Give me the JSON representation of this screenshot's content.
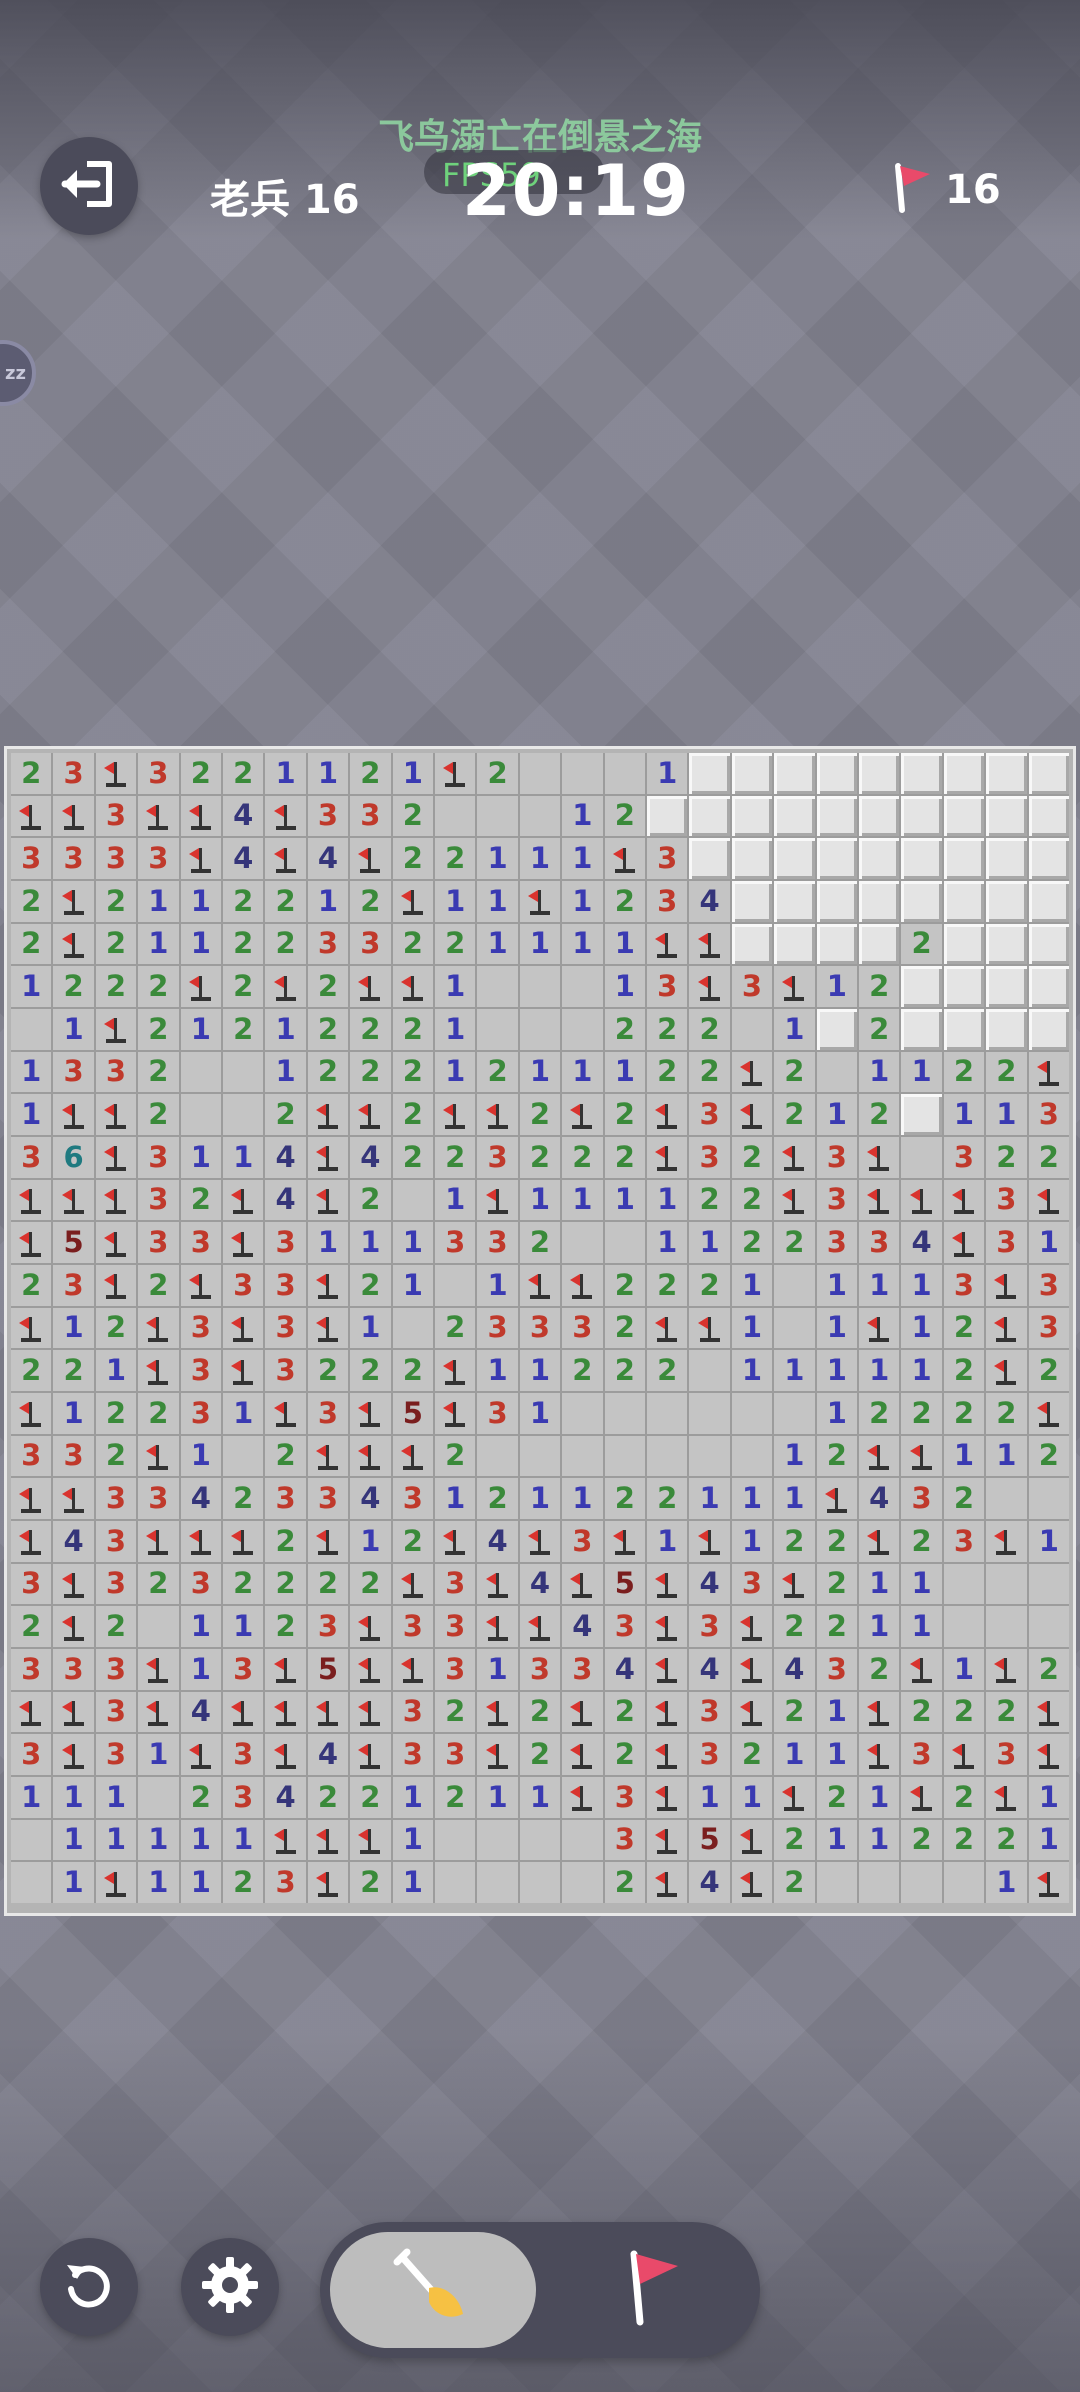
{
  "header": {
    "title_banner": "飞鸟溺亡在倒悬之海",
    "fps_label": "FPS59",
    "rank_label": "老兵 16",
    "timer": "20:19",
    "flag_count": "16"
  },
  "side_badge": {
    "text": "zz"
  },
  "icons": {
    "exit": "exit-icon",
    "restart": "restart-icon",
    "settings": "gear-icon",
    "dig": "shovel-icon",
    "flag": "flag-icon"
  },
  "colors": {
    "n1": "#3a3ab2",
    "n2": "#3a8a3a",
    "n3": "#c0392b",
    "n4": "#35357a",
    "n5": "#7a1e1e",
    "n6": "#1f7a80",
    "flag_pink": "#e94a6a"
  },
  "board": {
    "cols": 25,
    "rows": [
      "23F3221121F2...1HHHHHHHHHH",
      "FF3FF4F332...12HHHHHHHHHH",
      "3333F4F4F22111F3HHHHHHHHHH",
      "2F2112212F11F1234HHHHHHHHH",
      "2F2112233221111FFHHHH2HHHH",
      "1222F2F2FF1...13F3F12HHHHH",
      ".1F21212221...222.1H2HHHHH",
      "1332..12221211122F2.1122FF3",
      "1FF2..2FF2FF2F2F3F212H113F2",
      "36F3114F4223222F32F3F.32221",
      "FFF32F4F2.1F111122F3FFF3F1.",
      "F5F33F3111332..1122334F31.",
      "23F2F33F21.1FF2221.1113F3..",
      "F12F3F3F1.23332FF1.1F12F31.",
      "221F3F3222F11222.111112F21",
      "F12231F3F5F31......12222F2",
      "332F1.2FFF2.......12FF112F",
      "FF33423343121122111F432..11",
      "F43FFF2F12F4F3F1F122F23F1..",
      "3F3232222F3F4F5F43F211..",
      "2F2.1123F33FF43F3F2211..",
      "333F13F5FF31334F4F432F1F21.",
      "FF3F4FFFF32F2F2F3F21F222F21",
      "3F31F3F4F33F2F2F3211F3F3F21",
      "111.234221211F3F11F21F2F11F3F",
      ".11111FFF1....3F5F21122211F3F",
      ".1F1123F21....2F4F2....1F12F"
    ]
  }
}
